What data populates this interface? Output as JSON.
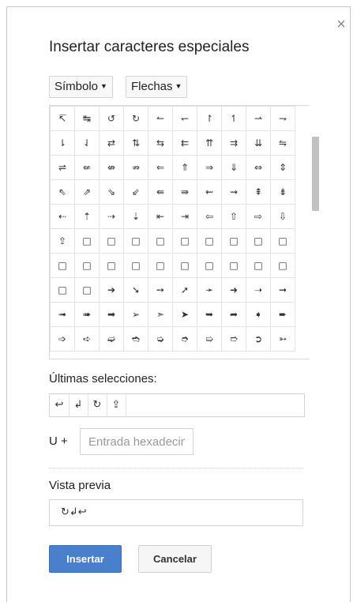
{
  "dialog": {
    "title": "Insertar caracteres especiales",
    "close_symbol": "×"
  },
  "category_dropdown": {
    "label": "Símbolo",
    "caret": "▼"
  },
  "subcategory_dropdown": {
    "label": "Flechas",
    "caret": "▼"
  },
  "grid": {
    "rows": [
      [
        "↸",
        "↹",
        "↺",
        "↻",
        "↼",
        "↽",
        "↾",
        "↿",
        "⇀",
        "⇁"
      ],
      [
        "⇂",
        "⇃",
        "⇄",
        "⇅",
        "⇆",
        "⇇",
        "⇈",
        "⇉",
        "⇊",
        "⇋"
      ],
      [
        "⇌",
        "⇍",
        "⇎",
        "⇏",
        "⇐",
        "⇑",
        "⇒",
        "⇓",
        "⇔",
        "⇕"
      ],
      [
        "⇖",
        "⇗",
        "⇘",
        "⇙",
        "⇚",
        "⇛",
        "⇜",
        "⇝",
        "⇞",
        "⇟"
      ],
      [
        "⇠",
        "⇡",
        "⇢",
        "⇣",
        "⇤",
        "⇥",
        "⇦",
        "⇧",
        "⇨",
        "⇩"
      ],
      [
        "⇪",
        "□",
        "□",
        "□",
        "□",
        "□",
        "□",
        "□",
        "□",
        "□"
      ],
      [
        "□",
        "□",
        "□",
        "□",
        "□",
        "□",
        "□",
        "□",
        "□",
        "□"
      ],
      [
        "□",
        "□",
        "➔",
        "➘",
        "➙",
        "➚",
        "➛",
        "➜",
        "➝",
        "➞"
      ],
      [
        "➟",
        "➠",
        "➡",
        "➢",
        "➣",
        "➤",
        "➥",
        "➦",
        "➧",
        "➨"
      ],
      [
        "➩",
        "➪",
        "➫",
        "➬",
        "➭",
        "➮",
        "➯",
        "➱",
        "➲",
        "➳"
      ]
    ]
  },
  "recent": {
    "label": "Últimas selecciones:",
    "items": [
      "↩",
      "↲",
      "↻",
      "⇪"
    ]
  },
  "hex": {
    "prefix": "U +",
    "placeholder": "Entrada hexadecimal"
  },
  "preview": {
    "label": "Vista previa",
    "value": "↻↲↩"
  },
  "buttons": {
    "insert": "Insertar",
    "cancel": "Cancelar"
  },
  "colors": {
    "primary": "#4a7fcc",
    "scroll_thumb": "#c1c1c1"
  }
}
